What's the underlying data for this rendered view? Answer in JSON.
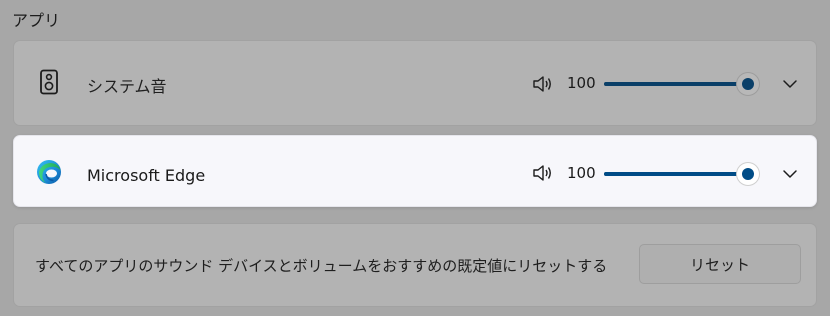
{
  "section": {
    "title": "アプリ"
  },
  "apps": [
    {
      "name": "システム音",
      "icon": "speaker-device-icon",
      "volume": "100",
      "volume_fraction": 1.0
    },
    {
      "name": "Microsoft Edge",
      "icon": "edge-logo-icon",
      "volume": "100",
      "volume_fraction": 1.0
    }
  ],
  "reset": {
    "description": "すべてのアプリのサウンド デバイスとボリュームをおすすめの既定値にリセットする",
    "button_label": "リセット"
  },
  "colors": {
    "accent": "#004c87",
    "overlay": "#a7a7a7",
    "card_highlight": "#f7f7fb"
  }
}
